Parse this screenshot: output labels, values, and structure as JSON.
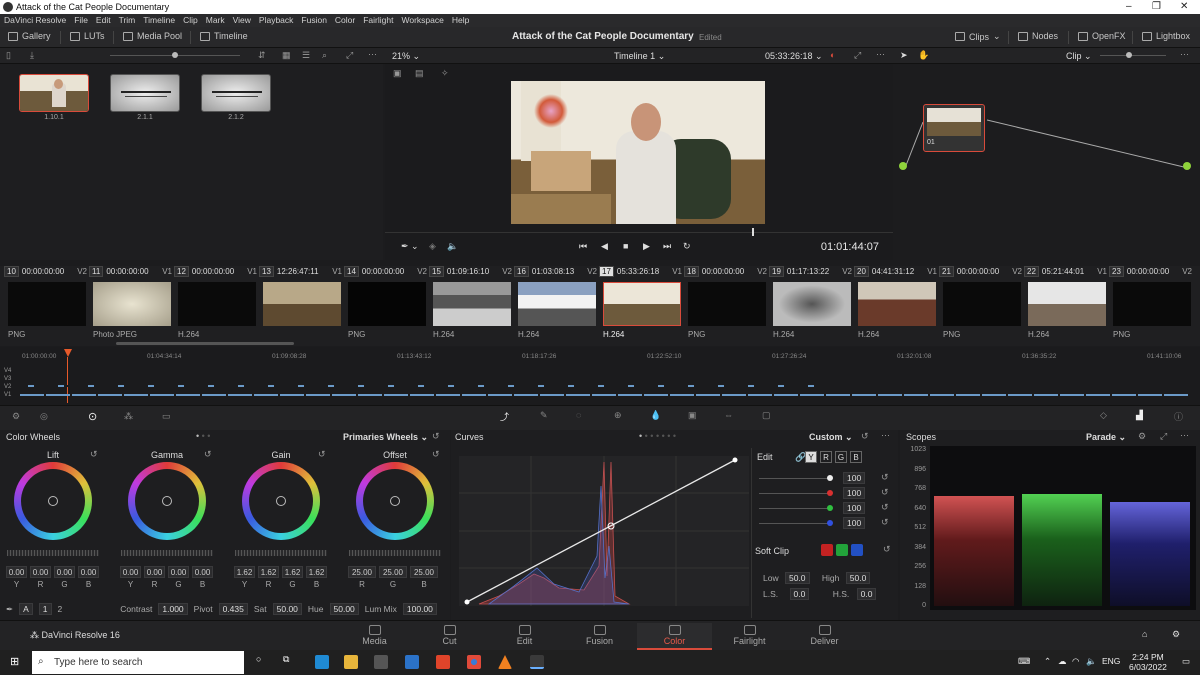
{
  "window": {
    "title": "Attack of the Cat People Documentary",
    "controls": [
      "–",
      "❐",
      "✕"
    ]
  },
  "menu": [
    "DaVinci Resolve",
    "File",
    "Edit",
    "Trim",
    "Timeline",
    "Clip",
    "Mark",
    "View",
    "Playback",
    "Fusion",
    "Color",
    "Fairlight",
    "Workspace",
    "Help"
  ],
  "toolbar": {
    "gallery": "Gallery",
    "luts": "LUTs",
    "media_pool": "Media Pool",
    "timeline": "Timeline",
    "project_title": "Attack of the Cat People Documentary",
    "edited": "Edited",
    "clips": "Clips",
    "nodes": "Nodes",
    "openfx": "OpenFX",
    "lightbox": "Lightbox"
  },
  "viewerbar": {
    "zoom": "21%",
    "timeline_name": "Timeline 1",
    "timecode": "05:33:26:18",
    "mode": "Clip"
  },
  "gallery": {
    "stills": [
      "1.10.1",
      "2.1.1",
      "2.1.2"
    ]
  },
  "viewer": {
    "current_timecode": "01:01:44:07"
  },
  "node": {
    "label": "01"
  },
  "clips": [
    {
      "num": "10",
      "tc": "00:00:00:00",
      "track": "V2",
      "codec": "PNG"
    },
    {
      "num": "11",
      "tc": "00:00:00:00",
      "track": "V1",
      "codec": "Photo JPEG"
    },
    {
      "num": "12",
      "tc": "00:00:00:00",
      "track": "V1",
      "codec": "H.264"
    },
    {
      "num": "13",
      "tc": "12:26:47:11",
      "track": "V1",
      "codec": ""
    },
    {
      "num": "14",
      "tc": "00:00:00:00",
      "track": "V2",
      "codec": "PNG"
    },
    {
      "num": "15",
      "tc": "01:09:16:10",
      "track": "V2",
      "codec": "H.264"
    },
    {
      "num": "16",
      "tc": "01:03:08:13",
      "track": "V2",
      "codec": "H.264"
    },
    {
      "num": "17",
      "tc": "05:33:26:18",
      "track": "V1",
      "codec": "H.264"
    },
    {
      "num": "18",
      "tc": "00:00:00:00",
      "track": "V2",
      "codec": "PNG"
    },
    {
      "num": "19",
      "tc": "01:17:13:22",
      "track": "V2",
      "codec": "H.264"
    },
    {
      "num": "20",
      "tc": "04:41:31:12",
      "track": "V1",
      "codec": "H.264"
    },
    {
      "num": "21",
      "tc": "00:00:00:00",
      "track": "V2",
      "codec": "PNG"
    },
    {
      "num": "22",
      "tc": "05:21:44:01",
      "track": "V1",
      "codec": "H.264"
    },
    {
      "num": "23",
      "tc": "00:00:00:00",
      "track": "V2",
      "codec": "PNG"
    }
  ],
  "mini_timeline": {
    "ruler": [
      "01:00:00:00",
      "01:04:34:14",
      "01:09:08:28",
      "01:13:43:12",
      "01:18:17:26",
      "01:22:52:10",
      "01:27:26:24",
      "01:32:01:08",
      "01:36:35:22",
      "01:41:10:06"
    ],
    "tracks": [
      "V4",
      "V3",
      "V2",
      "V1"
    ]
  },
  "wheels": {
    "title": "Color Wheels",
    "mode": "Primaries Wheels",
    "items": [
      {
        "name": "Lift",
        "values": [
          "0.00",
          "0.00",
          "0.00",
          "0.00"
        ],
        "chans": [
          "Y",
          "R",
          "G",
          "B"
        ]
      },
      {
        "name": "Gamma",
        "values": [
          "0.00",
          "0.00",
          "0.00",
          "0.00"
        ],
        "chans": [
          "Y",
          "R",
          "G",
          "B"
        ]
      },
      {
        "name": "Gain",
        "values": [
          "1.62",
          "1.62",
          "1.62",
          "1.62"
        ],
        "chans": [
          "Y",
          "R",
          "G",
          "B"
        ]
      },
      {
        "name": "Offset",
        "values": [
          "25.00",
          "25.00",
          "25.00"
        ],
        "chans": [
          "R",
          "G",
          "B"
        ]
      }
    ],
    "footer": {
      "contrast_label": "Contrast",
      "contrast": "1.000",
      "pivot_label": "Pivot",
      "pivot": "0.435",
      "sat_label": "Sat",
      "sat": "50.00",
      "hue_label": "Hue",
      "hue": "50.00",
      "lummix_label": "Lum Mix",
      "lummix": "100.00",
      "pages": [
        "1",
        "2"
      ],
      "a": "A"
    }
  },
  "curves": {
    "title": "Curves",
    "mode": "Custom",
    "edit": "Edit",
    "channels": [
      "Y",
      "R",
      "G",
      "B"
    ],
    "values": [
      "100",
      "100",
      "100",
      "100"
    ],
    "softclip": "Soft Clip",
    "low_label": "Low",
    "low": "50.0",
    "high_label": "High",
    "high": "50.0",
    "ls_label": "L.S.",
    "ls": "0.0",
    "hs_label": "H.S.",
    "hs": "0.0"
  },
  "scopes": {
    "title": "Scopes",
    "mode": "Parade",
    "scale": [
      "1023",
      "896",
      "768",
      "640",
      "512",
      "384",
      "256",
      "128",
      "0"
    ]
  },
  "pages": [
    {
      "name": "Media"
    },
    {
      "name": "Cut"
    },
    {
      "name": "Edit"
    },
    {
      "name": "Fusion"
    },
    {
      "name": "Color",
      "active": true
    },
    {
      "name": "Fairlight"
    },
    {
      "name": "Deliver"
    }
  ],
  "brand": "DaVinci Resolve 16",
  "taskbar": {
    "search_placeholder": "Type here to search",
    "lang": "ENG",
    "time": "2:24 PM",
    "date": "6/03/2022"
  },
  "colors": {
    "accent": "#d94b3b",
    "bg": "#1c1c1e"
  }
}
